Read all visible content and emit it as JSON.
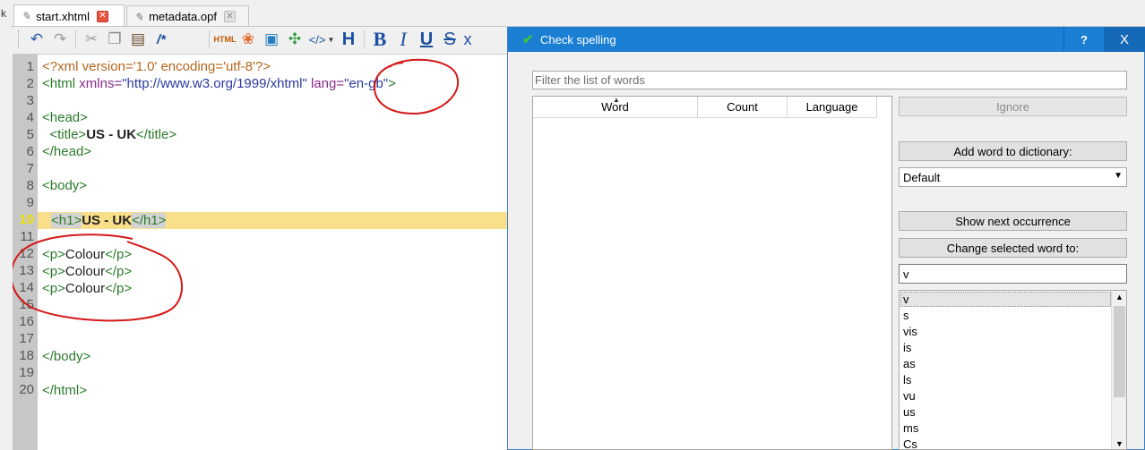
{
  "tabs": [
    {
      "label": "start.xhtml",
      "active": true
    },
    {
      "label": "metadata.opf",
      "active": false
    }
  ],
  "left_stub": "k",
  "toolbar": {
    "icons": [
      "undo-icon",
      "redo-icon",
      "cut-icon",
      "copy-icon",
      "paste-icon",
      "comment-icon",
      "html-icon",
      "tulip-icon",
      "image-icon",
      "link-icon",
      "code-icon",
      "heading-icon",
      "bold-icon",
      "italic-icon",
      "underline-icon",
      "strikethrough-icon",
      "subscript-icon"
    ],
    "comment_label": "/*",
    "bold_label": "B",
    "italic_label": "I",
    "underline_label": "U",
    "strike_label": "S",
    "sub_label": "x",
    "heading_label": "H",
    "code_label": "</>"
  },
  "editor": {
    "current_line": 10,
    "line_numbers": [
      "1",
      "2",
      "3",
      "4",
      "5",
      "6",
      "7",
      "8",
      "9",
      "10",
      "11",
      "12",
      "13",
      "14",
      "15",
      "16",
      "17",
      "18",
      "19",
      "20"
    ],
    "lines": {
      "l1": "<?xml version='1.0' encoding='utf-8'?>",
      "l2_tag": "<html",
      "l2_attr1": " xmlns=",
      "l2_val1": "\"http://www.w3.org/1999/xhtml\"",
      "l2_attr2": " lang=",
      "l2_val2": "\"en-gb\"",
      "l2_close": ">",
      "l4": "<head>",
      "l5_open": "  <title>",
      "l5_text": "US - UK",
      "l5_close": "</title>",
      "l6": "</head>",
      "l8": "<body>",
      "l10_open": "<h1>",
      "l10_text": "US - UK",
      "l10_close": "</h1>",
      "l12_open": "<p>",
      "l12_text": "Colour",
      "l12_close": "</p>",
      "l13_open": "<p>",
      "l13_text": "Colour",
      "l13_close": "</p>",
      "l14_open": "<p>",
      "l14_text": "Colour",
      "l14_close": "</p>",
      "l18": "</body>",
      "l20": "</html>"
    }
  },
  "dialog": {
    "title": "Check spelling",
    "help": "?",
    "close": "X",
    "filter_placeholder": "Filter the list of words",
    "columns": [
      "Word",
      "Count",
      "Language"
    ],
    "ignore_label": "Ignore",
    "add_word_label": "Add word to dictionary:",
    "dictionary_value": "Default",
    "show_next_label": "Show next occurrence",
    "change_word_label": "Change selected word to:",
    "change_value": "v",
    "suggestions": [
      "v",
      "s",
      "vis",
      "is",
      "as",
      "ls",
      "vu",
      "us",
      "ms",
      "Cs"
    ]
  }
}
